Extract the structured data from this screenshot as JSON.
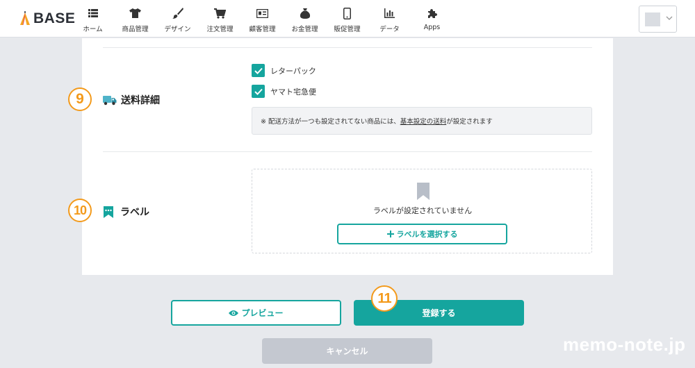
{
  "header": {
    "logo_text": "BASE",
    "nav": [
      {
        "label": "ホーム",
        "icon": "list-icon"
      },
      {
        "label": "商品管理",
        "icon": "tshirt-icon"
      },
      {
        "label": "デザイン",
        "icon": "brush-icon"
      },
      {
        "label": "注文管理",
        "icon": "cart-icon"
      },
      {
        "label": "顧客管理",
        "icon": "id-card-icon"
      },
      {
        "label": "お金管理",
        "icon": "money-bag-icon"
      },
      {
        "label": "販促管理",
        "icon": "smartphone-icon"
      },
      {
        "label": "データ",
        "icon": "bar-chart-icon"
      },
      {
        "label": "Apps",
        "icon": "puzzle-icon"
      }
    ]
  },
  "shipping": {
    "step_number": "9",
    "title": "送料詳細",
    "options": [
      {
        "label": "レターパック",
        "checked": true
      },
      {
        "label": "ヤマト宅急便",
        "checked": true
      }
    ],
    "notice_prefix": "※ 配送方法が一つも設定されてない商品には、",
    "notice_link": "基本設定の送料",
    "notice_suffix": "が設定されます"
  },
  "label_section": {
    "step_number": "10",
    "title": "ラベル",
    "empty_text": "ラベルが設定されていません",
    "select_button": "ラベルを選択する"
  },
  "actions": {
    "step_number": "11",
    "preview": "プレビュー",
    "register": "登録する",
    "cancel": "キャンセル"
  },
  "watermark": "memo-note.jp",
  "colors": {
    "accent": "#15a59e",
    "annotation": "#f39a1b",
    "background": "#e7e9ed",
    "cancel": "#c4c8d0"
  }
}
